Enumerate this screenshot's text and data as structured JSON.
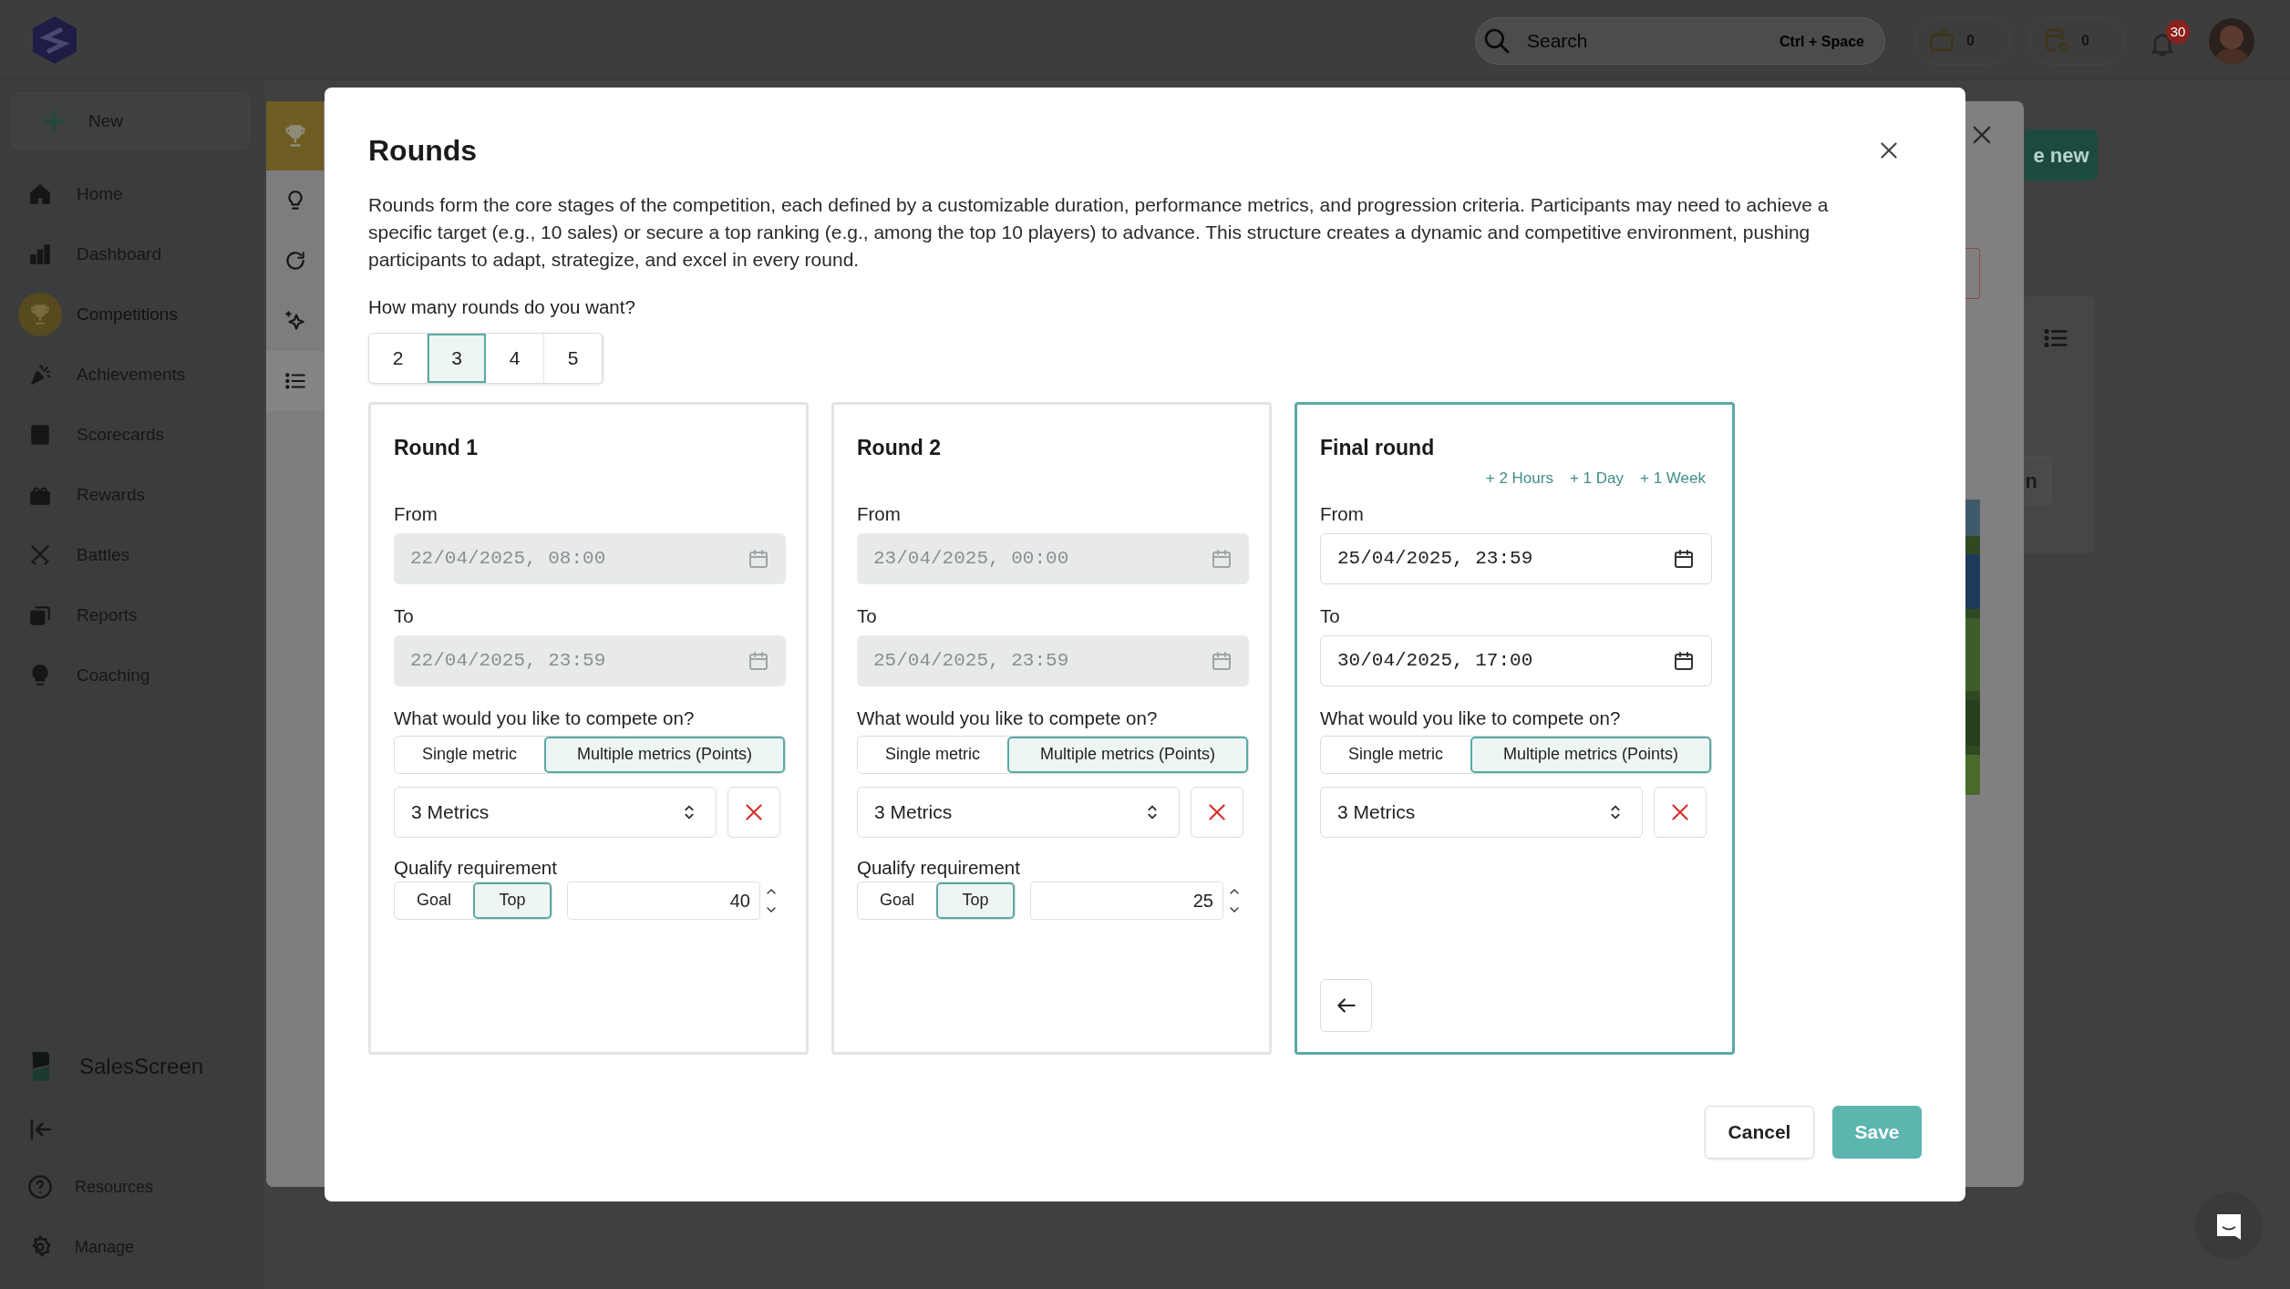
{
  "top_bar": {
    "search": {
      "placeholder": "Search",
      "shortcut": "Ctrl + Space"
    },
    "wallet_count": "0",
    "coins_count": "0",
    "notification_count": "30"
  },
  "sidebar": {
    "new_button": "New",
    "items": [
      {
        "label": "Home",
        "kind": "home",
        "selected": false
      },
      {
        "label": "Dashboard",
        "kind": "bars",
        "selected": false
      },
      {
        "label": "Competitions",
        "kind": "trophy",
        "selected": true
      },
      {
        "label": "Achievements",
        "kind": "party",
        "selected": false
      },
      {
        "label": "Scorecards",
        "kind": "card",
        "selected": false
      },
      {
        "label": "Rewards",
        "kind": "gift",
        "selected": false
      },
      {
        "label": "Battles",
        "kind": "swords",
        "selected": false
      },
      {
        "label": "Reports",
        "kind": "reports",
        "selected": false
      },
      {
        "label": "Coaching",
        "kind": "bulb",
        "selected": false
      }
    ],
    "brand": "SalesScreen",
    "footer_items": [
      {
        "label": "Resources",
        "kind": "help"
      },
      {
        "label": "Manage",
        "kind": "gear"
      }
    ]
  },
  "background": {
    "create_button": "e new",
    "side_button": "n"
  },
  "modal": {
    "title": "Rounds",
    "description": "Rounds form the core stages of the competition, each defined by a customizable duration, performance metrics, and progression criteria. Participants may need to achieve a specific target (e.g., 10 sales) or secure a top ranking (e.g., among the top 10 players) to advance. This structure creates a dynamic and competitive environment, pushing participants to adapt, strategize, and excel in every round.",
    "count_question": "How many rounds do you want?",
    "count_options": [
      {
        "label": "2",
        "selected": false
      },
      {
        "label": "3",
        "selected": true
      },
      {
        "label": "4",
        "selected": false
      },
      {
        "label": "5",
        "selected": false
      }
    ],
    "rounds": [
      {
        "title": "Round 1",
        "selected": false,
        "from": {
          "label": "From",
          "value": "22/04/2025, 08:00",
          "disabled": true
        },
        "to": {
          "label": "To",
          "value": "22/04/2025, 23:59",
          "disabled": true
        },
        "compete_label": "What would you like to compete on?",
        "metric_options": [
          {
            "label": "Single metric",
            "selected": false
          },
          {
            "label": "Multiple metrics (Points)",
            "selected": true
          }
        ],
        "metrics_value": "3 Metrics",
        "qualify": {
          "label": "Qualify requirement",
          "options": [
            {
              "label": "Goal",
              "selected": false
            },
            {
              "label": "Top",
              "selected": true
            }
          ],
          "value": "40"
        }
      },
      {
        "title": "Round 2",
        "selected": false,
        "from": {
          "label": "From",
          "value": "23/04/2025, 00:00",
          "disabled": true
        },
        "to": {
          "label": "To",
          "value": "25/04/2025, 23:59",
          "disabled": true
        },
        "compete_label": "What would you like to compete on?",
        "metric_options": [
          {
            "label": "Single metric",
            "selected": false
          },
          {
            "label": "Multiple metrics (Points)",
            "selected": true
          }
        ],
        "metrics_value": "3 Metrics",
        "qualify": {
          "label": "Qualify requirement",
          "options": [
            {
              "label": "Goal",
              "selected": false
            },
            {
              "label": "Top",
              "selected": true
            }
          ],
          "value": "25"
        }
      },
      {
        "title": "Final round",
        "selected": true,
        "quick_add": [
          "+ 2 Hours",
          "+ 1 Day",
          "+ 1 Week"
        ],
        "from": {
          "label": "From",
          "value": "25/04/2025, 23:59",
          "disabled": false
        },
        "to": {
          "label": "To",
          "value": "30/04/2025, 17:00",
          "disabled": false
        },
        "compete_label": "What would you like to compete on?",
        "metric_options": [
          {
            "label": "Single metric",
            "selected": false
          },
          {
            "label": "Multiple metrics (Points)",
            "selected": true
          }
        ],
        "metrics_value": "3 Metrics",
        "back_button": true
      }
    ],
    "cancel_button": "Cancel",
    "save_button": "Save"
  }
}
